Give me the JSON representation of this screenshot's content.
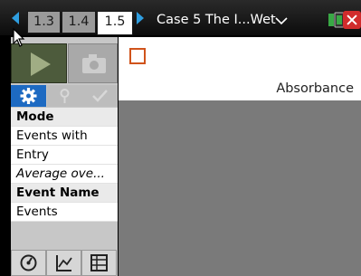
{
  "tabs": [
    {
      "label": "1.3",
      "active": false
    },
    {
      "label": "1.4",
      "active": false
    },
    {
      "label": "1.5",
      "active": true
    }
  ],
  "document_title": "Case 5 The I...Wet",
  "panel": {
    "properties": [
      {
        "text": "Mode",
        "style": "head"
      },
      {
        "text": "Events with",
        "style": "normal"
      },
      {
        "text": "Entry",
        "style": "normal"
      },
      {
        "text": "Average ove...",
        "style": "italic"
      },
      {
        "text": "Event Name",
        "style": "head"
      },
      {
        "text": "Events",
        "style": "normal"
      }
    ]
  },
  "content": {
    "column_label": "Absorbance"
  },
  "colors": {
    "accent_blue": "#1d6ac2",
    "play_green": "#4d5b3c",
    "orange": "#d0531b",
    "close_red": "#d12c2c"
  }
}
